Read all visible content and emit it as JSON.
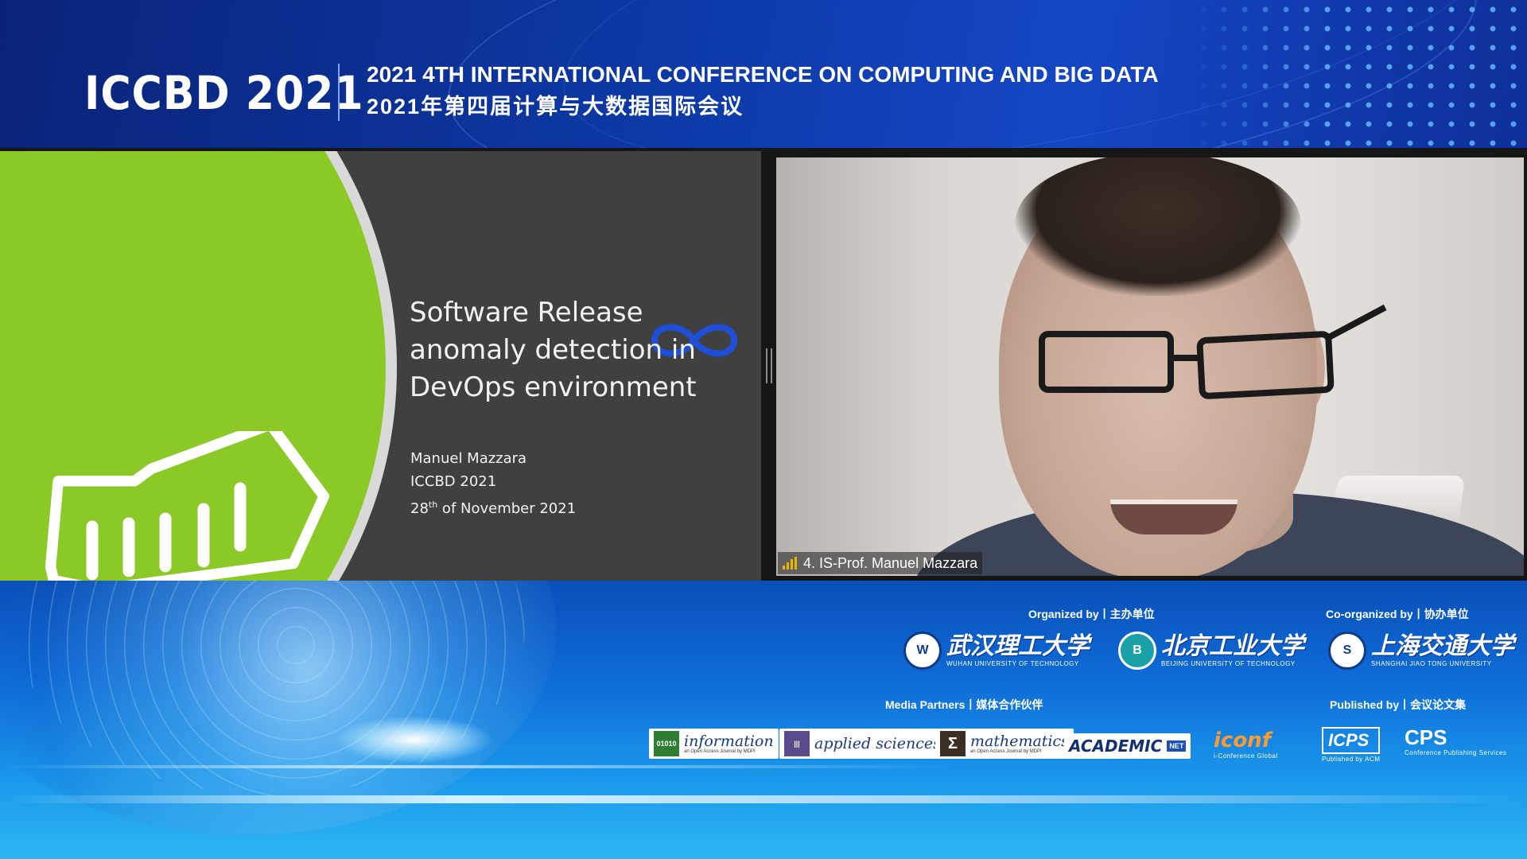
{
  "header": {
    "brand": "ICCBD 2021",
    "title_en": "2021 4TH INTERNATIONAL CONFERENCE ON COMPUTING AND BIG DATA",
    "title_zh": "2021年第四届计算与大数据国际会议"
  },
  "slide": {
    "title": "Software Release anomaly detection in DevOps environment",
    "author": "Manuel Mazzara",
    "conference": "ICCBD 2021",
    "date_day": "28",
    "date_suffix": "th",
    "date_rest": " of November 2021",
    "accent_green": "#8ac926",
    "logo_icon": "shipping-container-icon",
    "corner_icon": "infinity-icon"
  },
  "video": {
    "participant_label": "4. IS-Prof. Manuel Mazzara",
    "signal_icon": "signal-strength-icon"
  },
  "footer": {
    "organized_label": "Organized by丨主办单位",
    "coorganized_label": "Co-organized by丨协办单位",
    "media_label": "Media Partners丨媒体合作伙伴",
    "published_label": "Published by丨会议论文集",
    "organizers": [
      {
        "cn": "武汉理工大学",
        "en": "WUHAN UNIVERSITY OF TECHNOLOGY"
      },
      {
        "cn": "北京工业大学",
        "en": "BEIJING UNIVERSITY OF TECHNOLOGY"
      }
    ],
    "coorganizer": {
      "cn": "上海交通大学",
      "en": "SHANGHAI JIAO TONG UNIVERSITY"
    },
    "media": [
      {
        "name": "information",
        "sub": "an Open Access Journal by MDPI",
        "mark": "01010"
      },
      {
        "name": "applied sciences",
        "sub": "",
        "mark": "|||"
      },
      {
        "name": "mathematics",
        "sub": "an Open Access Journal by MDPI",
        "mark": "Σ"
      },
      {
        "name": "ACADEMIC",
        "badge": "NET"
      },
      {
        "name": "iconf",
        "sub": "i-Conference Global"
      }
    ],
    "publishers": [
      {
        "name": "ICPS",
        "sub": "Published by ACM"
      },
      {
        "name": "CPS",
        "sub": "Conference Publishing Services"
      }
    ]
  }
}
